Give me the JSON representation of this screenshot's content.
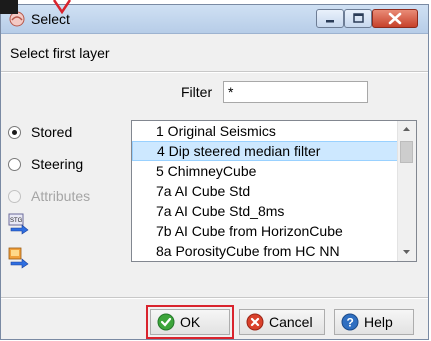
{
  "window": {
    "title": "Select",
    "title_icon": "app-icon",
    "controls": [
      "minimize-icon",
      "maximize-icon",
      "close-icon"
    ]
  },
  "header": {
    "label": "Select first layer"
  },
  "filter": {
    "label": "Filter",
    "value": "*"
  },
  "source_options": [
    {
      "label": "Stored",
      "selected": true,
      "enabled": true
    },
    {
      "label": "Steering",
      "selected": false,
      "enabled": true
    },
    {
      "label": "Attributes",
      "selected": false,
      "enabled": false
    }
  ],
  "tool_buttons": [
    "steering-data-icon",
    "import-icon"
  ],
  "layer_list": {
    "items": [
      "1 Original Seismics",
      "4 Dip steered median filter",
      "5 ChimneyCube",
      "7a AI Cube Std",
      "7a AI Cube Std_8ms",
      "7b AI Cube from HorizonCube",
      "8a PorosityCube from HC NN"
    ],
    "selected_index": 1
  },
  "buttons": {
    "ok": "OK",
    "cancel": "Cancel",
    "help": "Help"
  },
  "colors": {
    "selection": "#cde8ff",
    "highlight_frame": "#d9232d",
    "ok_icon": "#3da53b",
    "cancel_icon": "#d9412b",
    "help_icon": "#2f6fc1"
  }
}
